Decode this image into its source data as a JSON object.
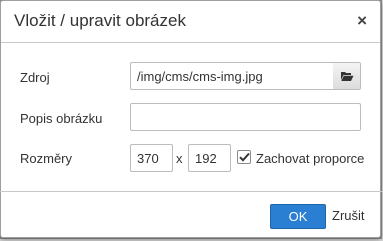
{
  "dialog": {
    "title": "Vložit / upravit obrázek",
    "close_symbol": "×",
    "close_icon": "close-icon"
  },
  "form": {
    "source": {
      "label": "Zdroj",
      "value": "/img/cms/cms-img.jpg",
      "browse_icon": "folder-open-icon"
    },
    "description": {
      "label": "Popis obrázku",
      "value": ""
    },
    "dimensions": {
      "label": "Rozměry",
      "width": "370",
      "separator": "x",
      "height": "192",
      "keep_ratio_label": "Zachovat proporce",
      "keep_ratio_checked": true
    }
  },
  "footer": {
    "ok_label": "OK",
    "cancel_label": "Zrušit"
  },
  "colors": {
    "primary_button": "#2a7fd2",
    "overlay": "#8f8f8f"
  }
}
